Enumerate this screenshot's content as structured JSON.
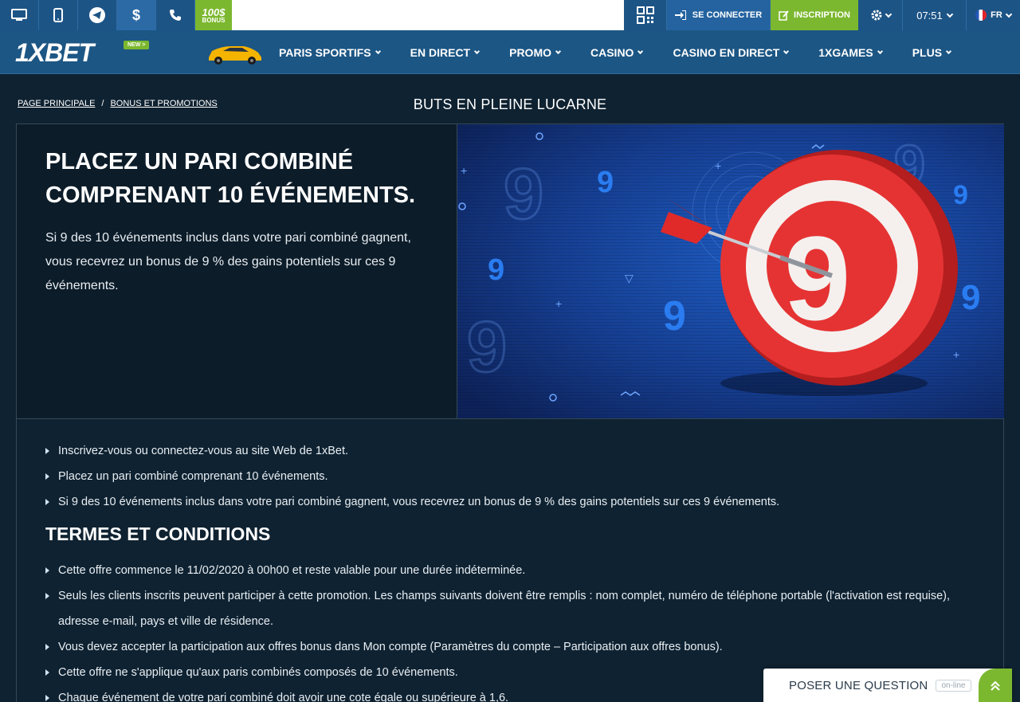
{
  "topbar": {
    "bonus_amount": "100$",
    "bonus_label": "BONUS",
    "login_label": "SE CONNECTER",
    "signup_label": "INSCRIPTION",
    "time": "07:51",
    "language": "FR"
  },
  "nav": {
    "logo": "1XBET",
    "new_badge": "NEW >",
    "items": [
      {
        "label": "PARIS SPORTIFS"
      },
      {
        "label": "EN DIRECT"
      },
      {
        "label": "PROMO"
      },
      {
        "label": "CASINO"
      },
      {
        "label": "CASINO EN DIRECT"
      },
      {
        "label": "1XGAMES"
      },
      {
        "label": "PLUS"
      }
    ]
  },
  "breadcrumb": {
    "home": "PAGE PRINCIPALE",
    "separator": "/",
    "section": "BONUS ET PROMOTIONS"
  },
  "page_title": "BUTS EN PLEINE LUCARNE",
  "hero": {
    "title": "PLACEZ UN PARI COMBINÉ COMPRENANT 10 ÉVÉNEMENTS.",
    "text": "Si 9 des 10 événements inclus dans votre pari combiné gagnent, vous recevrez un bonus de 9 % des gains potentiels sur ces 9 événements."
  },
  "steps": [
    "Inscrivez-vous ou connectez-vous au site Web de 1xBet.",
    "Placez un pari combiné comprenant 10 événements.",
    "Si 9 des 10 événements inclus dans votre pari combiné gagnent, vous recevrez un bonus de 9 % des gains potentiels sur ces 9 événements."
  ],
  "terms": {
    "title": "TERMES ET CONDITIONS",
    "items": [
      "Cette offre commence le 11/02/2020 à 00h00 et reste valable pour une durée indéterminée.",
      "Seuls les clients inscrits peuvent participer à cette promotion. Les champs suivants doivent être remplis : nom complet, numéro de téléphone portable (l'activation est requise), adresse e-mail, pays et ville de résidence.",
      "Vous devez accepter la participation aux offres bonus dans Mon compte (Paramètres du compte – Participation aux offres bonus).",
      "Cette offre ne s'applique qu'aux paris combinés composés de 10 événements.",
      "Chaque événement de votre pari combiné doit avoir une cote égale ou supérieure à 1,6."
    ]
  },
  "chat": {
    "label": "POSER UNE QUESTION",
    "status": "on-line"
  },
  "colors": {
    "accent_green": "#7cb82f",
    "header_blue": "#1c5684",
    "background": "#0f2231"
  }
}
